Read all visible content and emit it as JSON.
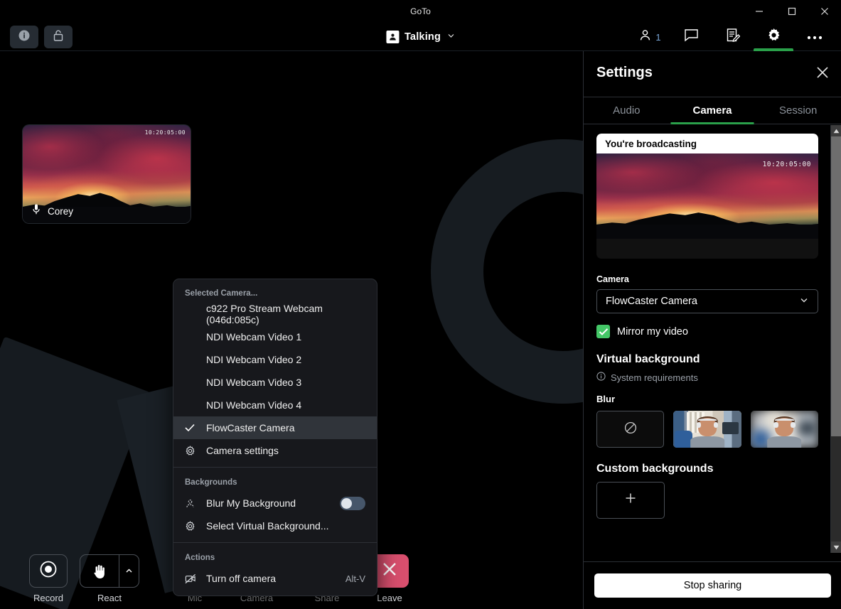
{
  "window": {
    "title": "GoTo",
    "minimize_label": "Minimize",
    "maximize_label": "Maximize",
    "close_label": "Close"
  },
  "appbar": {
    "info_icon": "info-icon",
    "lock_icon": "unlocked-padlock-icon",
    "status_label": "Talking",
    "status_chevron": "chevron-down-icon",
    "participants_count": "1",
    "participants_icon": "person-icon",
    "chat_icon": "chat-bubble-icon",
    "notes_icon": "notes-icon",
    "settings_icon": "gear-icon",
    "more_icon": "ellipsis-icon",
    "accent_color": "#2aa04a"
  },
  "stage": {
    "participant": {
      "name": "Corey",
      "mic_icon": "microphone-icon",
      "timecode": "10:20:05:00"
    }
  },
  "camera_menu": {
    "header": "Selected Camera...",
    "devices": [
      {
        "label": "c922 Pro Stream Webcam (046d:085c)",
        "selected": false
      },
      {
        "label": "NDI Webcam Video 1",
        "selected": false
      },
      {
        "label": "NDI Webcam Video 2",
        "selected": false
      },
      {
        "label": "NDI Webcam Video 3",
        "selected": false
      },
      {
        "label": "NDI Webcam Video 4",
        "selected": false
      },
      {
        "label": "FlowCaster Camera",
        "selected": true
      }
    ],
    "camera_settings": {
      "label": "Camera settings",
      "icon": "gear-icon"
    },
    "backgrounds_header": "Backgrounds",
    "blur_background": {
      "label": "Blur My Background",
      "icon": "person-blur-icon",
      "enabled": false
    },
    "select_virtual_background": {
      "label": "Select Virtual Background...",
      "icon": "gear-icon"
    },
    "actions_header": "Actions",
    "turn_off_camera": {
      "label": "Turn off camera",
      "shortcut": "Alt-V",
      "icon": "camera-off-icon"
    },
    "check_icon": "check-icon"
  },
  "controls": [
    {
      "label": "Record",
      "icon": "record-icon",
      "style": "plain",
      "has_arrow": false
    },
    {
      "label": "React",
      "icon": "hand-icon",
      "style": "plain",
      "has_arrow": true
    },
    {
      "label": "Mic",
      "icon": "microphone-icon",
      "style": "active",
      "has_arrow": false
    },
    {
      "label": "Camera",
      "icon": "camera-icon",
      "style": "active",
      "has_arrow": true
    },
    {
      "label": "Share",
      "icon": "screen-share-off-icon",
      "style": "plain",
      "has_arrow": true
    },
    {
      "label": "Leave",
      "icon": "close-icon",
      "style": "leave",
      "has_arrow": false
    }
  ],
  "settings": {
    "title": "Settings",
    "close_icon": "close-icon",
    "tabs": [
      {
        "label": "Audio",
        "active": false
      },
      {
        "label": "Camera",
        "active": true
      },
      {
        "label": "Session",
        "active": false
      }
    ],
    "preview": {
      "banner": "You're broadcasting",
      "timecode": "10:20:05:00"
    },
    "camera_field_label": "Camera",
    "camera_selected": "FlowCaster Camera",
    "camera_chevron": "chevron-down-icon",
    "mirror": {
      "label": "Mirror my video",
      "checked": true,
      "check_color": "#44c767"
    },
    "virtual_background_header": "Virtual background",
    "system_requirements": {
      "label": "System requirements",
      "icon": "info-icon"
    },
    "blur_label": "Blur",
    "blur_options": [
      {
        "name": "none",
        "icon": "no-blur-icon"
      },
      {
        "name": "light-blur",
        "icon": "person-preview"
      },
      {
        "name": "heavy-blur",
        "icon": "person-preview-blurred"
      }
    ],
    "custom_backgrounds_label": "Custom backgrounds",
    "add_background_icon": "plus-icon",
    "stop_sharing_label": "Stop sharing",
    "scrollbar": {
      "up_icon": "caret-up-icon",
      "down_icon": "caret-down-icon"
    }
  }
}
